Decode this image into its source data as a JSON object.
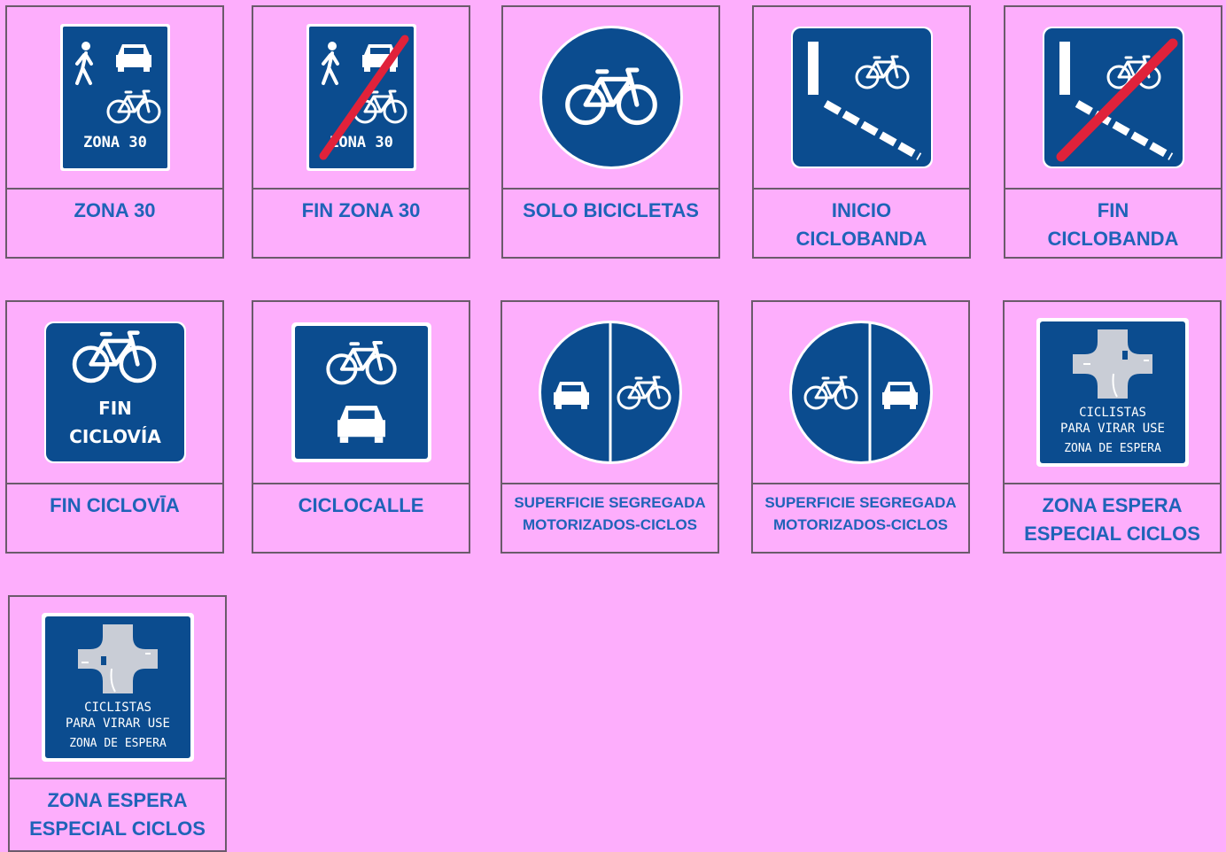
{
  "colors": {
    "background": "#fdaefc",
    "sign_blue": "#0b4c8f",
    "caption_blue": "#1f63b8",
    "cancel_red": "#e0223a",
    "border": "#6b5a6b"
  },
  "signs": [
    {
      "caption": "ZONA 30",
      "icon": "zona-30-sign",
      "sign_text": "ZONA 30"
    },
    {
      "caption": "FIN ZONA 30",
      "icon": "fin-zona-30-sign",
      "sign_text": "ZONA 30"
    },
    {
      "caption": "SOLO BICICLETAS",
      "icon": "solo-bicicletas-sign"
    },
    {
      "caption": "INICIO\nCICLOBANDA",
      "icon": "inicio-ciclobanda-sign"
    },
    {
      "caption": "FIN\nCICLOBANDA",
      "icon": "fin-ciclobanda-sign"
    },
    {
      "caption": "FIN CICLOVĪA",
      "icon": "fin-ciclovia-sign",
      "sign_text_1": "FIN",
      "sign_text_2": "CICLOVÍA"
    },
    {
      "caption": "CICLOCALLE",
      "icon": "ciclocalle-sign"
    },
    {
      "caption": "SUPERFICIE SEGREGADA\nMOTORIZADOS-CICLOS",
      "icon": "segregada-car-bike-sign"
    },
    {
      "caption": "SUPERFICIE SEGREGADA\nMOTORIZADOS-CICLOS",
      "icon": "segregada-bike-car-sign"
    },
    {
      "caption": "ZONA ESPERA\nESPECIAL CICLOS",
      "icon": "zona-espera-sign",
      "sign_text_1": "CICLISTAS",
      "sign_text_2": "PARA VIRAR USE",
      "sign_text_3": "ZONA DE ESPERA"
    },
    {
      "caption": "ZONA ESPERA\nESPECIAL CICLOS",
      "icon": "zona-espera-sign",
      "sign_text_1": "CICLISTAS",
      "sign_text_2": "PARA VIRAR USE",
      "sign_text_3": "ZONA DE ESPERA"
    }
  ]
}
